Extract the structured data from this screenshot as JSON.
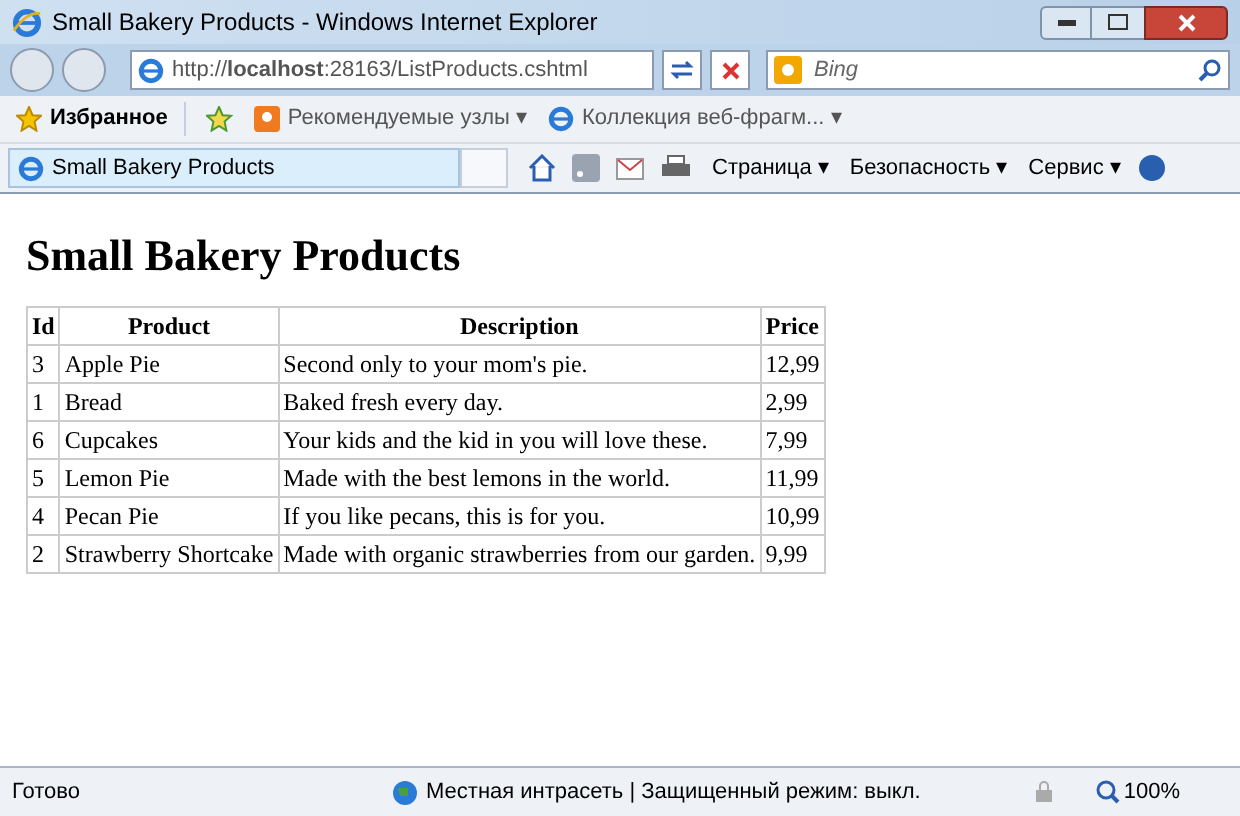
{
  "window": {
    "title": "Small Bakery Products - Windows Internet Explorer"
  },
  "address_bar": {
    "url": "http://**localhost**:28163/ListProducts.cshtml"
  },
  "search": {
    "placeholder": "Bing"
  },
  "favorites_bar": {
    "items": [
      {
        "label": "Избранное",
        "kind": "favorites"
      },
      {
        "label": "Рекомендуемые узлы ▾",
        "kind": "suggested"
      },
      {
        "label": "Коллекция веб-фрагм... ▾",
        "kind": "webslice"
      }
    ]
  },
  "tab": {
    "title": "Small Bakery Products"
  },
  "command_bar": {
    "menus": [
      "Страница ▾",
      "Безопасность ▾",
      "Сервис ▾"
    ]
  },
  "page": {
    "heading": "Small Bakery Products",
    "table": {
      "columns": [
        "Id",
        "Product",
        "Description",
        "Price"
      ],
      "rows": [
        [
          "3",
          "Apple Pie",
          "Second only to your mom's pie.",
          "12,99"
        ],
        [
          "1",
          "Bread",
          "Baked fresh every day.",
          "2,99"
        ],
        [
          "6",
          "Cupcakes",
          "Your kids and the kid in you will love these.",
          "7,99"
        ],
        [
          "5",
          "Lemon Pie",
          "Made with the best lemons in the world.",
          "11,99"
        ],
        [
          "4",
          "Pecan Pie",
          "If you like pecans, this is for you.",
          "10,99"
        ],
        [
          "2",
          "Strawberry Shortcake",
          "Made with organic strawberries from our garden.",
          "9,99"
        ]
      ]
    }
  },
  "status_bar": {
    "status": "Готово",
    "zone": "Местная интрасеть | Защищенный режим: выкл.",
    "zoom": "100%"
  }
}
